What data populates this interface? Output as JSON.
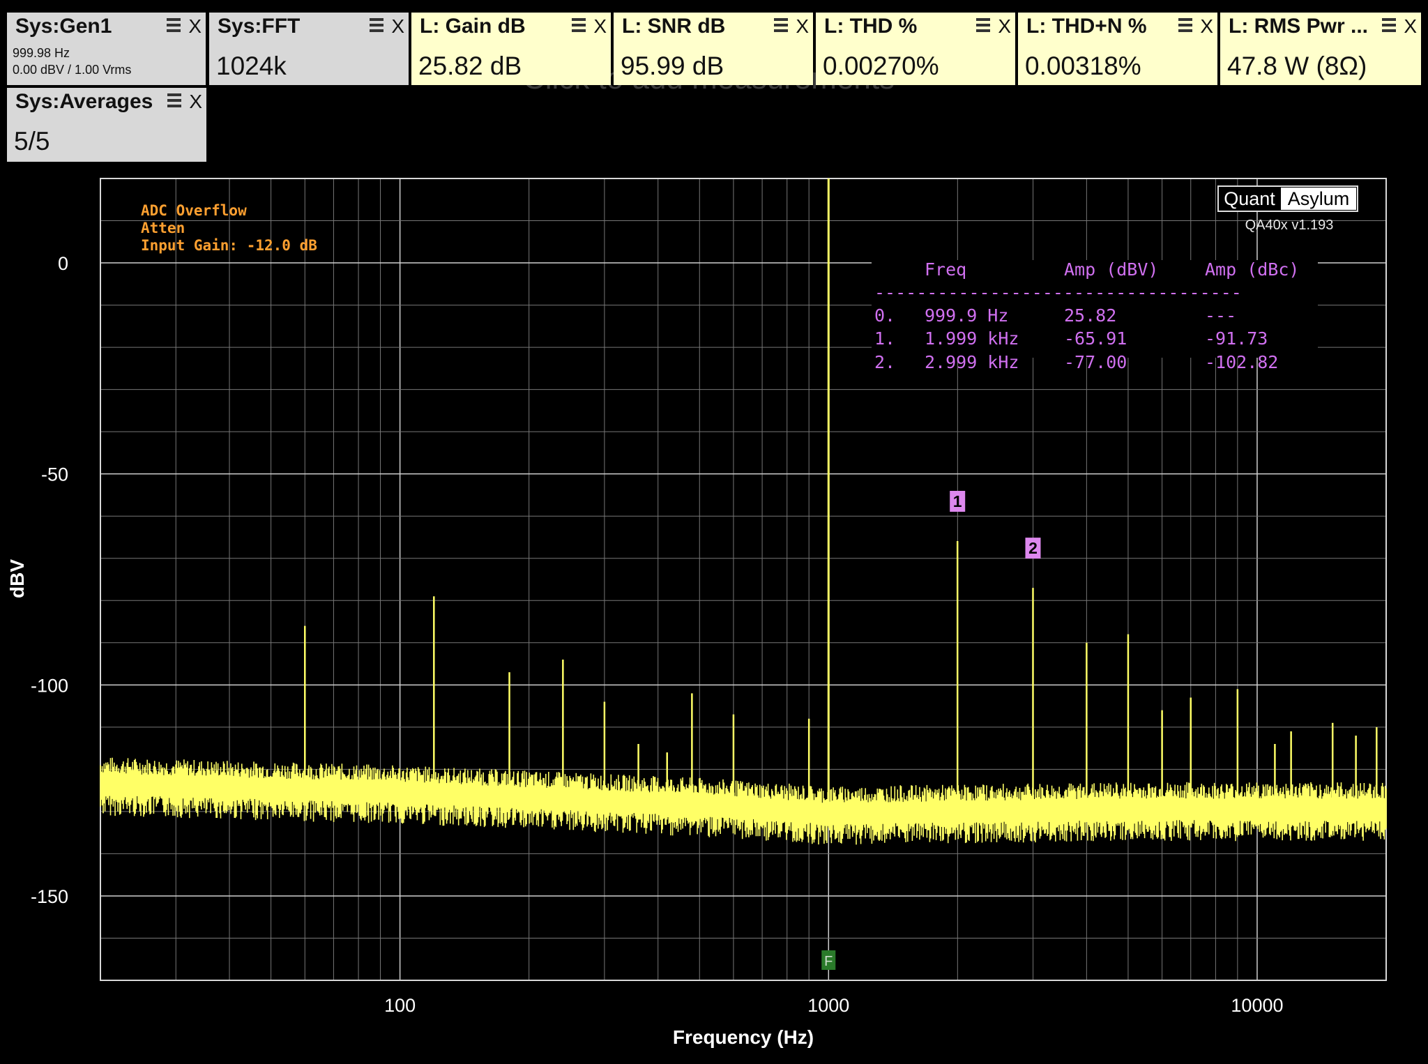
{
  "tiles": [
    {
      "title": "Sys:Gen1",
      "kind": "sys",
      "sub1": "999.98 Hz",
      "sub2": "0.00 dBV  / 1.00 Vrms"
    },
    {
      "title": "Sys:FFT",
      "kind": "sys",
      "value": "1024k"
    },
    {
      "title": "L: Gain dB",
      "kind": "meas",
      "value": "25.82 dB"
    },
    {
      "title": "L: SNR dB",
      "kind": "meas",
      "value": "95.99 dB"
    },
    {
      "title": "L: THD %",
      "kind": "meas",
      "value": "0.00270%"
    },
    {
      "title": "L: THD+N %",
      "kind": "meas",
      "value": "0.00318%"
    },
    {
      "title": "L: RMS Pwr ...",
      "kind": "meas",
      "value": "47.8 W (8Ω)"
    },
    {
      "title": "Sys:Averages",
      "kind": "sys",
      "value": "5/5"
    }
  ],
  "close_glyph": "X",
  "add_measurements_hint": "Click to add measurements",
  "chart_data": {
    "type": "line",
    "xlabel": "Frequency (Hz)",
    "ylabel": "dBV",
    "xscale": "log",
    "xlim": [
      20,
      20000
    ],
    "ylim": [
      -170,
      20
    ],
    "x_ticks": [
      100,
      1000,
      10000
    ],
    "y_ticks": [
      0,
      -50,
      -100,
      -150
    ],
    "grid": true,
    "status_lines": [
      "ADC Overflow",
      "Atten",
      "Input Gain: -12.0 dB"
    ],
    "brand": {
      "left": "Quant",
      "right": "Asylum",
      "version": "QA40x v1.193"
    },
    "noise_floor": [
      [
        20,
        -123
      ],
      [
        100,
        -125
      ],
      [
        500,
        -128
      ],
      [
        1000,
        -130
      ],
      [
        5000,
        -129
      ],
      [
        20000,
        -129
      ]
    ],
    "spurs": [
      {
        "x": 60,
        "y": -86
      },
      {
        "x": 120,
        "y": -79
      },
      {
        "x": 180,
        "y": -97
      },
      {
        "x": 240,
        "y": -94
      },
      {
        "x": 300,
        "y": -104
      },
      {
        "x": 360,
        "y": -114
      },
      {
        "x": 420,
        "y": -116
      },
      {
        "x": 480,
        "y": -102
      },
      {
        "x": 600,
        "y": -107
      },
      {
        "x": 900,
        "y": -108
      },
      {
        "x": 1999,
        "y": -65.91
      },
      {
        "x": 2999,
        "y": -77.0
      },
      {
        "x": 4000,
        "y": -90
      },
      {
        "x": 5000,
        "y": -88
      },
      {
        "x": 6000,
        "y": -106
      },
      {
        "x": 7000,
        "y": -103
      },
      {
        "x": 9000,
        "y": -101
      },
      {
        "x": 11000,
        "y": -114
      },
      {
        "x": 12000,
        "y": -111
      },
      {
        "x": 15000,
        "y": -109
      },
      {
        "x": 17000,
        "y": -112
      },
      {
        "x": 19000,
        "y": -110
      }
    ],
    "fundamental": {
      "x": 999.9,
      "y": 25.82,
      "label": "F"
    },
    "markers": [
      {
        "label": "1",
        "x": 1999,
        "y": -65.91
      },
      {
        "label": "2",
        "x": 2999,
        "y": -77.0
      }
    ],
    "harmonic_table": {
      "headers": [
        "Freq",
        "Amp (dBV)",
        "Amp (dBc)"
      ],
      "separator": "-----------------------------------",
      "rows": [
        {
          "idx": "0.",
          "freq": "999.9 Hz",
          "dbv": "25.82",
          "dbc": "---"
        },
        {
          "idx": "1.",
          "freq": "1.999 kHz",
          "dbv": "-65.91",
          "dbc": "-91.73"
        },
        {
          "idx": "2.",
          "freq": "2.999 kHz",
          "dbv": "-77.00",
          "dbc": "-102.82"
        }
      ]
    },
    "colors": {
      "trace": "#ffff66",
      "marker": "#dd88ee",
      "table": "#d070f0",
      "status": "#ffa030",
      "fundamental_marker": "#2a7a2a",
      "grid": "#a0a0a0"
    }
  }
}
